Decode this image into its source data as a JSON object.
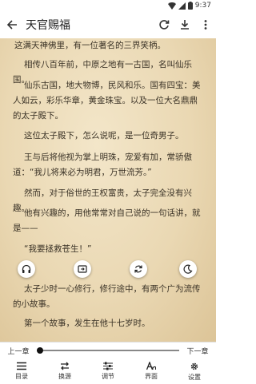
{
  "status": {
    "time": "9:37"
  },
  "appbar": {
    "title": "天官赐福"
  },
  "reader": {
    "paragraphs": [
      "这满天神佛里，有一位著名的三界笑柄。",
      "相传八百年前，中原之地有一古国，名叫仙乐国。",
      "仙乐古国，地大物博，民风和乐。国有四宝：美人如云，彩乐华章，黄金珠宝。以及一位大名鼎鼎的太子殿下。",
      "这位太子殿下，怎么说呢，是一位奇男子。",
      "王与后将他视为掌上明珠，宠爱有加，常骄傲道：“我儿将来必为明君，万世流芳。”",
      "然而，对于俗世的王权富贵，太子完全没有兴趣。",
      "他有兴趣的，用他常常对自己说的一句话讲，就是——",
      "“我要拯救苍生！”",
      ".",
      "太子少时一心修行，修行途中，有两个广为流传的小故事。",
      "第一个故事，发生在他十七岁时。"
    ]
  },
  "bottom": {
    "prev_chapter": "上一章",
    "next_chapter": "下一章",
    "progress": 0.02,
    "tabs": [
      {
        "label": "目录",
        "icon": "list-icon"
      },
      {
        "label": "换源",
        "icon": "swap-icon"
      },
      {
        "label": "调节",
        "icon": "sliders-icon"
      },
      {
        "label": "界面",
        "icon": "font-icon"
      },
      {
        "label": "设置",
        "icon": "gear-icon"
      }
    ]
  }
}
